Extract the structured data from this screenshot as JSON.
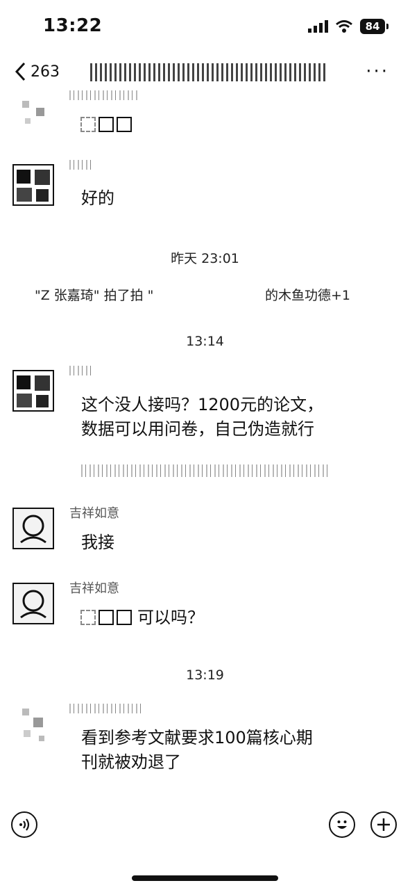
{
  "status_bar": {
    "time": "13:22",
    "battery": "84"
  },
  "nav": {
    "back_count": "263"
  },
  "messages": {
    "m2_text": "好的",
    "stamp1": "昨天 23:01",
    "sys_left": "\"Z 张嘉琦\" 拍了拍 \"",
    "sys_right": "的木鱼功德+1",
    "stamp2": "13:14",
    "m3_line1": "这个没人接吗？1200元的论文，",
    "m3_line2": "数据可以用问卷，自己伪造就行",
    "m4_name": "吉祥如意",
    "m4_text": "我接",
    "m5_name": "吉祥如意",
    "m5_text": "可以吗？",
    "stamp3": "13:19",
    "m6_line1": "看到参考文献要求100篇核心期",
    "m6_line2": "刊就被劝退了"
  },
  "icons": {
    "back": "chevron-left-icon",
    "more": "more-dots-icon",
    "voice": "voice-icon",
    "emoji": "emoji-icon",
    "plus": "plus-icon"
  }
}
